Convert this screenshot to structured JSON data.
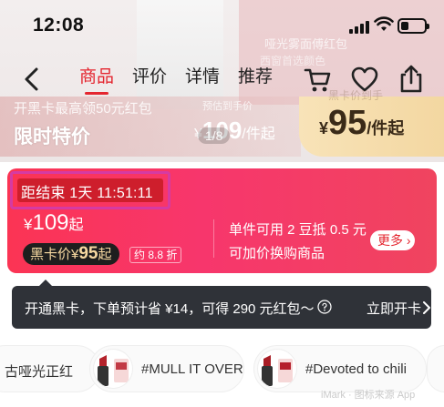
{
  "status_bar": {
    "time": "12:08"
  },
  "hero": {
    "ghost_text_1": "哑光雾面傅红包",
    "ghost_text_2": "西窗首选颜色"
  },
  "navbar": {
    "tabs": [
      {
        "label": "商品",
        "active": true
      },
      {
        "label": "评价",
        "active": false
      },
      {
        "label": "详情",
        "active": false
      },
      {
        "label": "推荐",
        "active": false
      }
    ],
    "icons": [
      "back-arrow-icon",
      "cart-icon",
      "heart-icon",
      "share-icon"
    ]
  },
  "promo_strip": {
    "blackcard_text": "开黑卡最高领50元红包",
    "limited_label": "限时特价",
    "pre_price_label": "预估到手价",
    "price_currency": "¥",
    "price_value": "109",
    "price_unit": "/件起",
    "page_indicator": "1/8",
    "right_ghost": "黑卡价到手",
    "right_price_currency": "¥",
    "right_price_value": "95",
    "right_price_unit": "/件起"
  },
  "sale_card": {
    "countdown": "距结束 1天 11:51:11",
    "price_currency": "¥",
    "price_value": "109",
    "price_suffix": "起",
    "blackcard_label": "黑卡价",
    "blackcard_currency": "¥",
    "blackcard_value": "95",
    "blackcard_suffix": "起",
    "discount": "约 8.8 折",
    "note_1": "单件可用 2 豆抵 0.5 元",
    "note_2": "可加价换购商品",
    "more_label": "更多",
    "colors": {
      "accent": "#fb3454",
      "countdown_bg": "#ce1e2c",
      "highlight": "#d63aa3"
    }
  },
  "blackcard_banner": {
    "text": "开通黑卡，下单预计省 ¥14，可得 290 元红包～",
    "cta": "立即开卡"
  },
  "shades": [
    {
      "label": "古哑光正红"
    },
    {
      "label": "#MULL IT OVER"
    },
    {
      "label": "#Devoted to chili"
    }
  ],
  "watermark": "iMark · 图标来源 App"
}
